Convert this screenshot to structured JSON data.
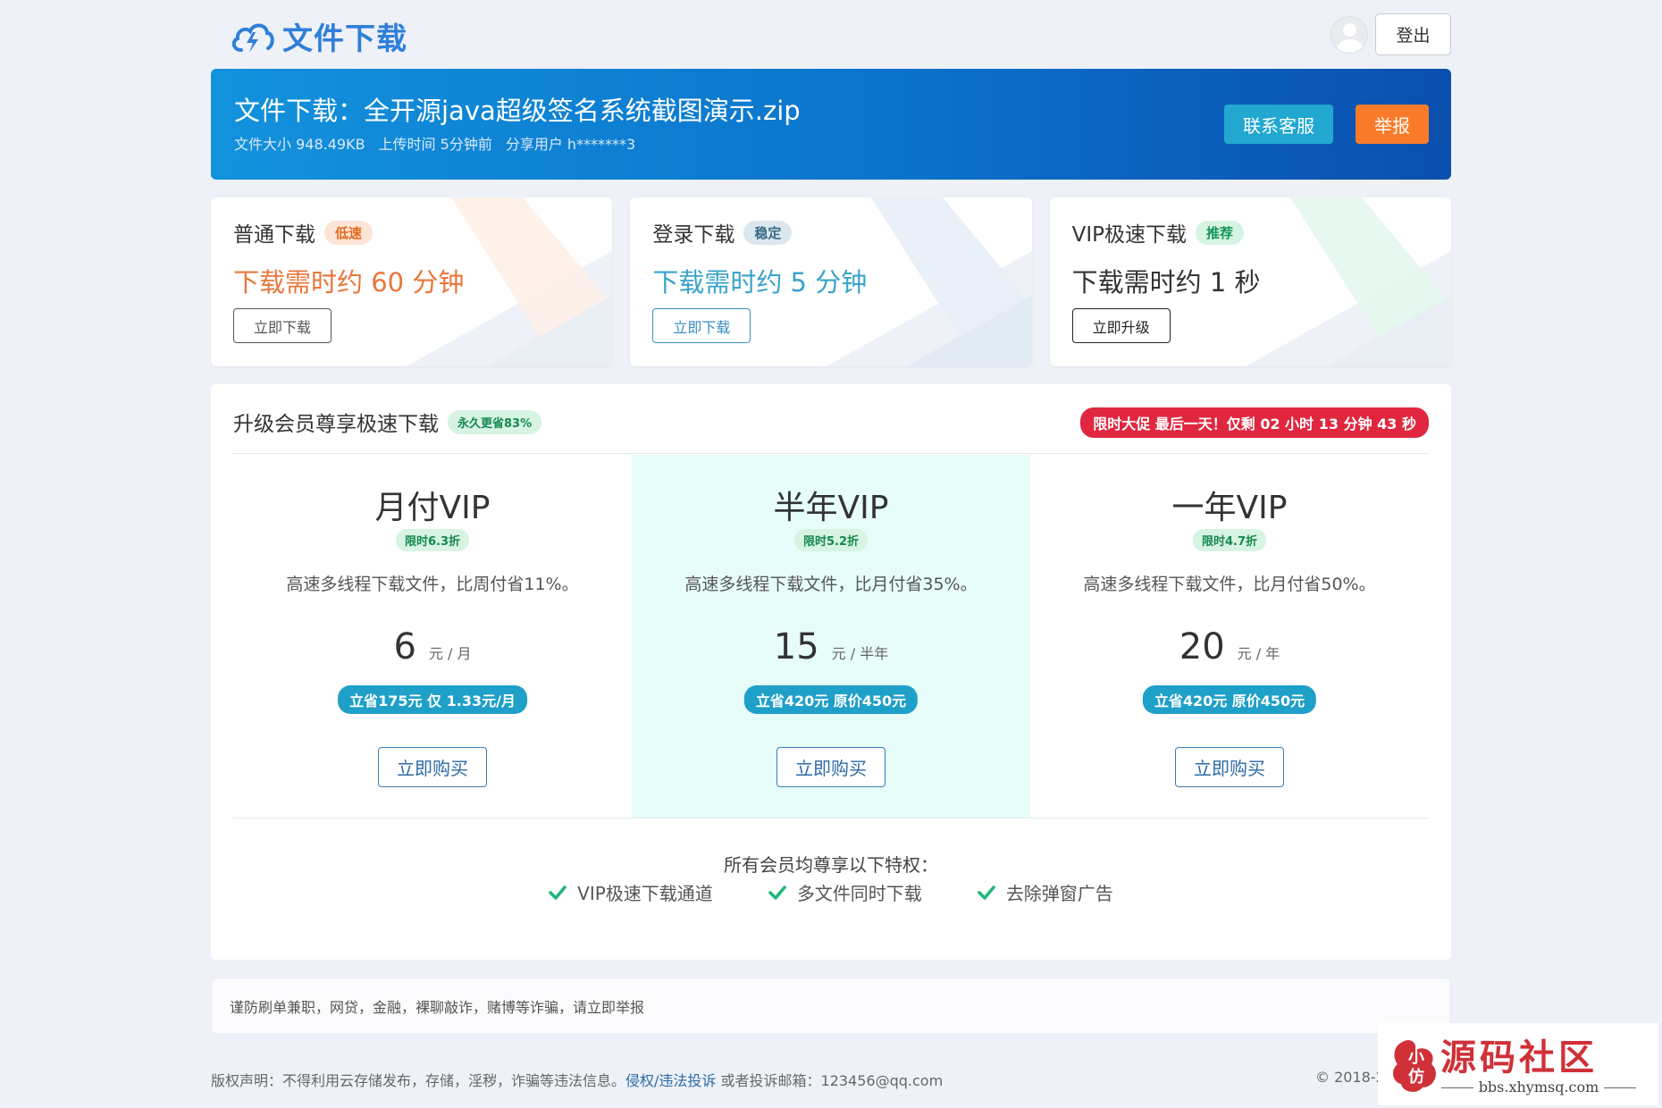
{
  "header": {
    "logo_text": "文件下载",
    "logout_label": "登出"
  },
  "file": {
    "title": "文件下载：全开源java超级签名系统截图演示.zip",
    "size": "文件大小 948.49KB",
    "upload_time": "上传时间 5分钟前",
    "share_user": "分享用户 h*******3",
    "service_label": "联系客服",
    "report_label": "举报"
  },
  "download_options": [
    {
      "title": "普通下载",
      "tag": "低速",
      "time": "下载需时约 60 分钟",
      "button": "立即下载",
      "time_color": "#e9763a"
    },
    {
      "title": "登录下载",
      "tag": "稳定",
      "time": "下载需时约 5 分钟",
      "button": "立即下载",
      "time_color": "#3aa3c8"
    },
    {
      "title": "VIP极速下载",
      "tag": "推荐",
      "time": "下载需时约 1 秒",
      "button": "立即升级",
      "time_color": "#333333"
    }
  ],
  "vip": {
    "title": "升级会员尊享极速下载",
    "tag": "永久更省83%",
    "promo": "限时大促 最后一天！仅剩 02 小时 13 分钟 43 秒",
    "plans": [
      {
        "name": "月付VIP",
        "discount": "限时6.3折",
        "desc": "高速多线程下载文件，比周付省11%。",
        "price": "6",
        "unit": "元 / 月",
        "save": "立省175元 仅 1.33元/月",
        "buy": "立即购买"
      },
      {
        "name": "半年VIP",
        "discount": "限时5.2折",
        "desc": "高速多线程下载文件，比月付省35%。",
        "price": "15",
        "unit": "元 / 半年",
        "save": "立省420元 原价450元",
        "buy": "立即购买"
      },
      {
        "name": "一年VIP",
        "discount": "限时4.7折",
        "desc": "高速多线程下载文件，比月付省50%。",
        "price": "20",
        "unit": "元 / 年",
        "save": "立省420元 原价450元",
        "buy": "立即购买"
      }
    ],
    "perks_title": "所有会员均尊享以下特权：",
    "perks": [
      "VIP极速下载通道",
      "多文件同时下载",
      "去除弹窗广告"
    ]
  },
  "notice": "谨防刷单兼职，网贷，金融，裸聊敲诈，赌博等诈骗，请立即举报",
  "footer": {
    "text_before": "版权声明：不得利用云存储发布，存储，淫秽，诈骗等违法信息。",
    "link": "侵权/违法投诉",
    "text_after": " 或者投诉邮箱：123456@qq.com",
    "copyright": "© 2018-2"
  },
  "watermark": {
    "title": "源码社区",
    "url": "bbs.xhymsq.com"
  },
  "colors": {
    "brand_blue": "#2f7fd8",
    "banner_from": "#1392dc",
    "banner_to": "#0b4fae",
    "report_orange": "#f97b2a",
    "promo_red": "#e0273f",
    "check_green": "#1fb57a"
  }
}
